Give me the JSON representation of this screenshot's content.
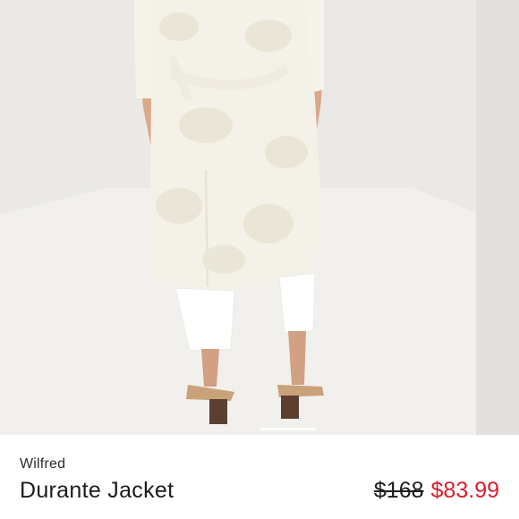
{
  "product": {
    "brand": "Wilfred",
    "name": "Durante Jacket",
    "price_original": "$168",
    "price_sale": "$83.99"
  },
  "colors": {
    "sale_price": "#d91e2a",
    "text": "#1c1c1c",
    "garment": "#f4f1e8",
    "pants": "#ffffff",
    "sandal": "#c9a27a",
    "heel": "#5b4031"
  },
  "media": {
    "image_subject": "model-wearing-jacket-back-view"
  }
}
